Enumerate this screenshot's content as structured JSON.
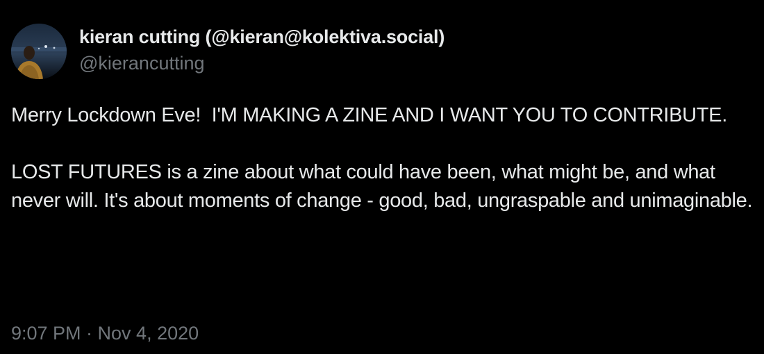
{
  "author": {
    "display_name": "kieran cutting (@kieran@kolektiva.social)",
    "handle": "@kierancutting"
  },
  "tweet": {
    "paragraphs": [
      "Merry Lockdown Eve!  I'M MAKING A ZINE AND I WANT YOU TO CONTRIBUTE.",
      "LOST FUTURES is a zine about what could have been, what might be, and what never will. It's about moments of change - good, bad, ungraspable and unimaginable."
    ],
    "timestamp": "9:07 PM · Nov 4, 2020"
  },
  "colors": {
    "background": "#000000",
    "primary_text": "#e7e9ea",
    "secondary_text": "#71767b"
  }
}
